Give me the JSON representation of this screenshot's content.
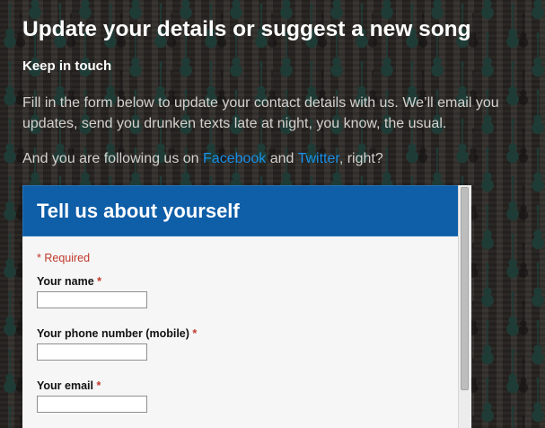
{
  "background": {
    "motif_icon": "guitar-silhouette-icon",
    "base_color": "#2f2b28",
    "motif_color": "#1f3b36"
  },
  "page": {
    "title": "Update your details or suggest a new song",
    "section_heading": "Keep in touch",
    "intro": "Fill in the form below to update your contact details with us. We’ll email you updates, send you drunken texts late at night, you know, the usual.",
    "follow": {
      "prefix": "And you are following us on ",
      "facebook": "Facebook",
      "middle": " and ",
      "twitter": "Twitter",
      "suffix": ", right?"
    },
    "link_color": "#1a8fe6"
  },
  "form": {
    "header_color": "#0e5ea8",
    "title": "Tell us about yourself",
    "required_note": "* Required",
    "fields": [
      {
        "label": "Your name",
        "required_mark": "*",
        "value": ""
      },
      {
        "label": "Your phone number (mobile)",
        "required_mark": "*",
        "value": ""
      },
      {
        "label": "Your email",
        "required_mark": "*",
        "value": ""
      }
    ]
  }
}
